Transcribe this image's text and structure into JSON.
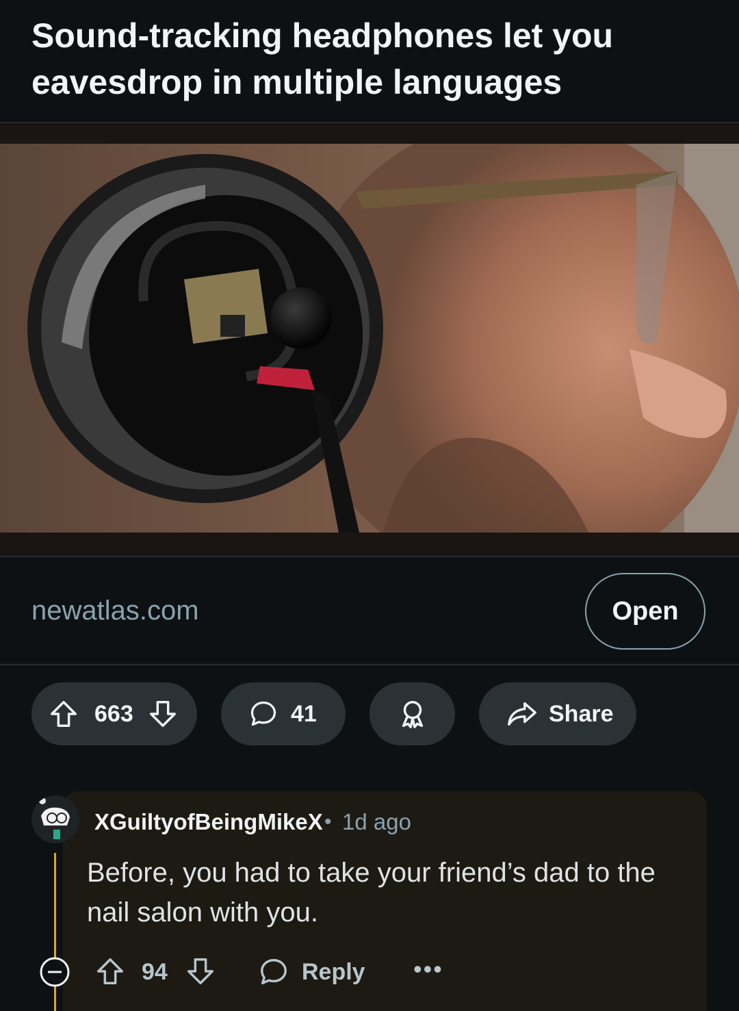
{
  "post": {
    "title": "Sound-tracking headphones let you eavesdrop in multiple languages",
    "image_alt": "Man wearing headphones with exposed electronics and a microphone"
  },
  "link": {
    "domain": "newatlas.com",
    "open_label": "Open"
  },
  "actions": {
    "upvotes": "663",
    "comments": "41",
    "share_label": "Share",
    "upvote_icon": "arrow-up-icon",
    "downvote_icon": "arrow-down-icon",
    "comment_icon": "speech-bubble-icon",
    "award_icon": "award-icon",
    "share_icon": "share-arrow-icon"
  },
  "comment": {
    "username": "XGuiltyofBeingMikeX",
    "separator": "•",
    "age": "1d ago",
    "body": "Before, you had to take your friend’s dad to the nail salon with you.",
    "upvotes": "94",
    "reply_label": "Reply",
    "more_label": "•••",
    "thread_color": "#d8a72a"
  },
  "colors": {
    "background": "#0e1113",
    "pill": "#2a3236",
    "muted_text": "#8ba2ad",
    "comment_card": "#1d1a13"
  }
}
